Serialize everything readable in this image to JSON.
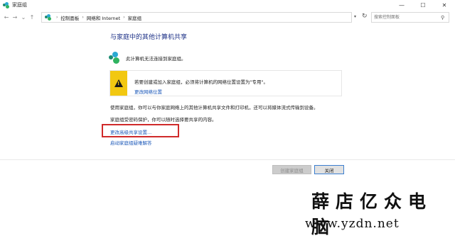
{
  "window": {
    "title": "家庭组",
    "minimize_glyph": "—",
    "maximize_glyph": "☐",
    "close_glyph": "✕"
  },
  "nav": {
    "back_glyph": "←",
    "forward_glyph": "→",
    "recent_glyph": "⌄",
    "up_glyph": "↑"
  },
  "breadcrumb": {
    "items": [
      "控制面板",
      "网络和 Internet",
      "家庭组"
    ],
    "separator": "›"
  },
  "search": {
    "placeholder": "搜索控制面板"
  },
  "main": {
    "heading": "与家庭中的其他计算机共享",
    "status_text": "此计算机无法连接到家庭组。",
    "warning": {
      "text": "若要创建或加入家庭组，必须将计算机的网络位置设置为\"专用\"。",
      "link": "更改网络位置"
    },
    "paragraph1": "使用家庭组，你可以与你家庭网络上的其他计算机共享文件和打印机，还可以将媒体流式传输到设备。",
    "paragraph2": "家庭组受密码保护，你可以随时选择要共享的内容。",
    "link_advanced": "更改高级共享设置...",
    "link_troubleshoot": "启动家庭组疑难解答"
  },
  "buttons": {
    "create": "创建家庭组",
    "close": "关闭"
  },
  "watermark": {
    "brand": "薛店亿众电脑",
    "url": "www.yzdn.net"
  },
  "colors": {
    "heading": "#1e3287",
    "link": "#1a57b8",
    "warning_stripe": "#f2c811",
    "highlight_border": "#d02a2a"
  },
  "icons": {
    "app": "homegroup-icon",
    "search": "search-icon",
    "warning": "warning-icon",
    "refresh": "refresh-icon"
  }
}
